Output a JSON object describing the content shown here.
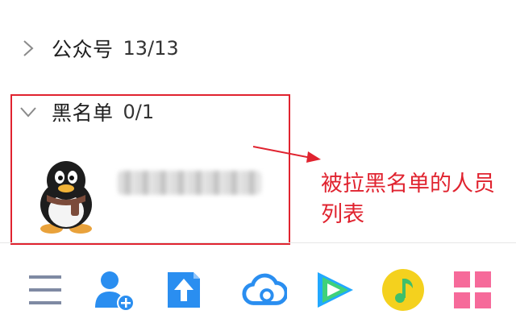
{
  "groups": [
    {
      "name": "公众号",
      "count": "13/13",
      "expanded": false
    },
    {
      "name": "黑名单",
      "count": "0/1",
      "expanded": true
    }
  ],
  "annotation": {
    "text": "被拉黑名单的人员列表",
    "color": "#e0232f"
  },
  "toolbar": {
    "icons": [
      "menu-icon",
      "add-contact-icon",
      "file-transfer-icon",
      "weiyun-cloud-icon",
      "tencent-video-icon",
      "qq-music-icon",
      "apps-grid-icon"
    ]
  },
  "colors": {
    "accent": "#e0232f",
    "brand_blue": "#2a8ef0",
    "music_yellow": "#f4d11e",
    "apps_pink": "#f66a9a"
  }
}
